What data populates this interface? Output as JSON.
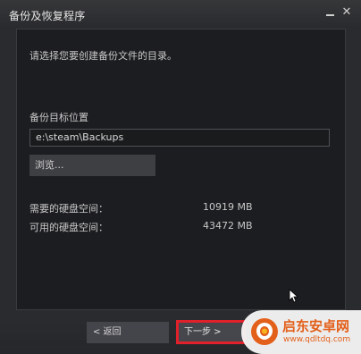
{
  "window": {
    "title": "备份及恢复程序",
    "minimize_icon": "minimize-icon",
    "close_icon": "close-icon",
    "close_glyph": "✕"
  },
  "content": {
    "prompt": "请选择您要创建备份文件的目录。",
    "location_label": "备份目标位置",
    "path_value": "e:\\steam\\Backups",
    "browse_label": "浏览...",
    "required_space_label": "需要的硬盘空间：",
    "required_space_value": "10919 MB",
    "available_space_label": "可用的硬盘空间：",
    "available_space_value": "43472 MB"
  },
  "footer": {
    "back_label": "< 返回",
    "next_label": "下一步 >"
  },
  "watermark": {
    "name": "启东安卓网",
    "url": "www.qdltdq.com"
  },
  "colors": {
    "highlight": "#e0202a",
    "watermark_accent": "#e3601b"
  }
}
